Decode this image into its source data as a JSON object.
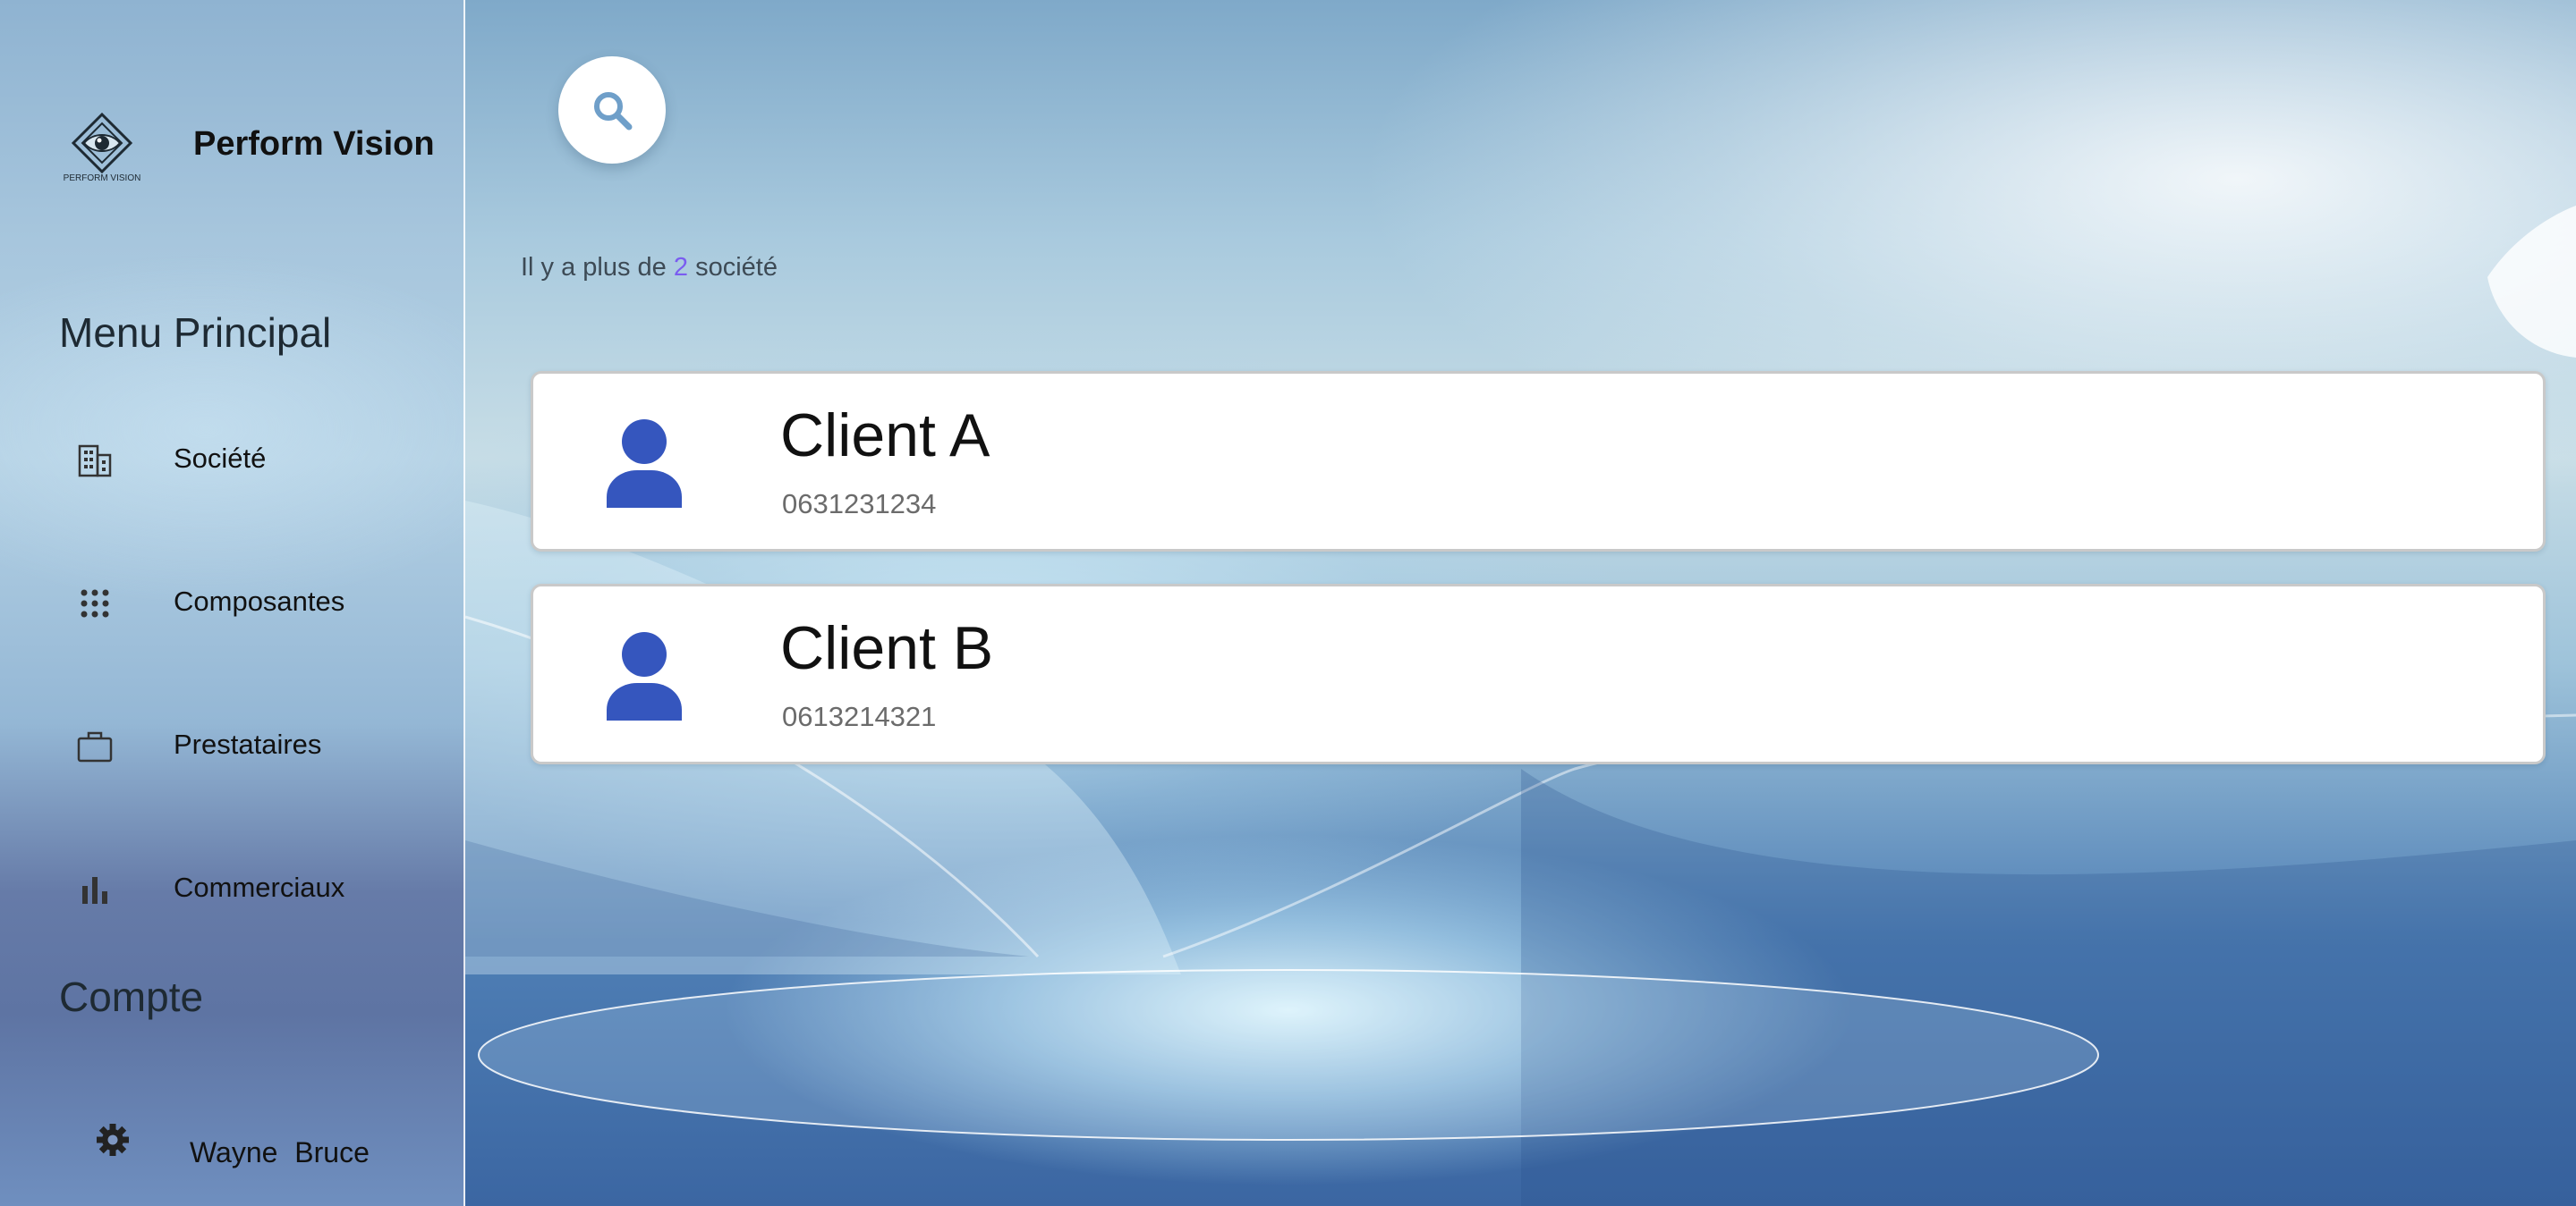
{
  "brand": {
    "name": "Perform Vision",
    "logo_text": "PERFORM VISION"
  },
  "sidebar": {
    "main_menu_title": "Menu Principal",
    "items": [
      {
        "label": "Société",
        "icon": "building-icon"
      },
      {
        "label": "Composantes",
        "icon": "apps-grid-icon"
      },
      {
        "label": "Prestataires",
        "icon": "briefcase-icon"
      },
      {
        "label": "Commerciaux",
        "icon": "bar-chart-icon"
      }
    ],
    "account_title": "Compte",
    "account": {
      "name": "Wayne  Bruce",
      "icon": "gear-icon"
    }
  },
  "search": {
    "icon": "search-icon"
  },
  "summary": {
    "prefix": "Il y a plus de ",
    "count": "2",
    "suffix": " société"
  },
  "clients": [
    {
      "name": "Client A",
      "phone": "0631231234",
      "icon": "person-icon"
    },
    {
      "name": "Client B",
      "phone": "0613214321",
      "icon": "person-icon"
    }
  ],
  "colors": {
    "accent_count": "#7a5cf0",
    "avatar": "#3556be",
    "search_icon": "#6f9fc9"
  }
}
